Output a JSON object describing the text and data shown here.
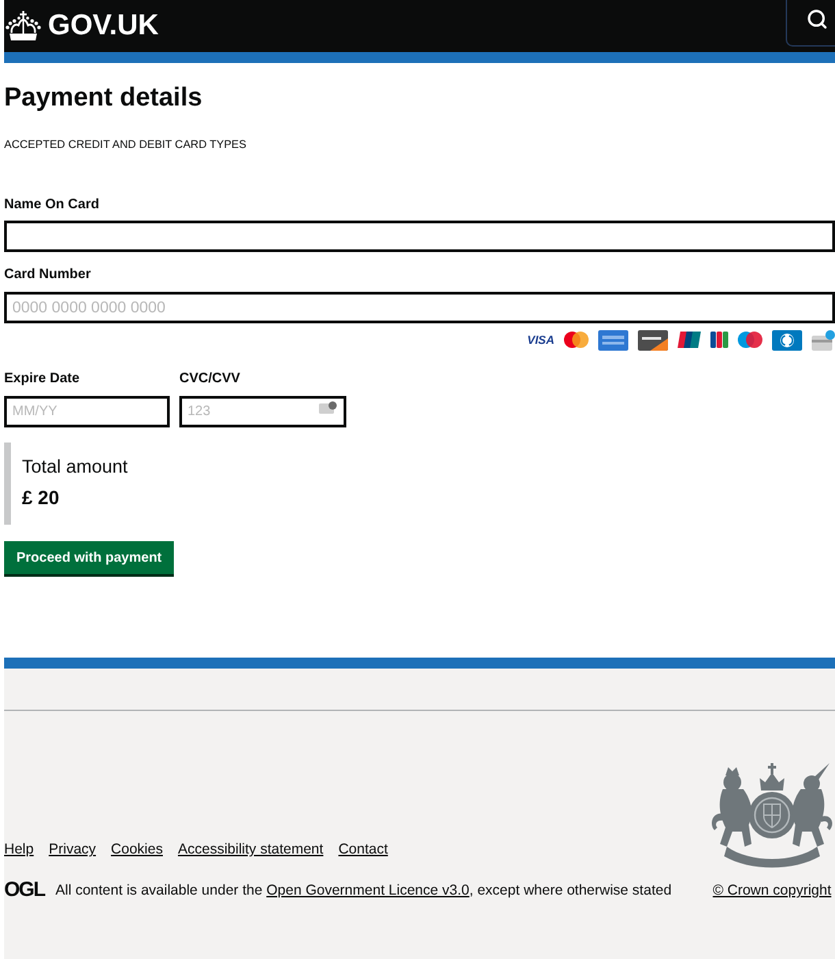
{
  "header": {
    "logo_text": "GOV.UK"
  },
  "form": {
    "title": "Payment details",
    "card_types_label": "ACCEPTED CREDIT AND DEBIT CARD TYPES",
    "name_on_card": {
      "label": "Name On Card"
    },
    "card_number": {
      "label": "Card Number",
      "placeholder": "0000 0000 0000 0000",
      "visa_logo": "VISA"
    },
    "expire_date": {
      "label": "Expire Date",
      "placeholder": "MM/YY"
    },
    "cvc": {
      "label": "CVC/CVV",
      "placeholder": "123"
    }
  },
  "total": {
    "label": "Total amount",
    "amount": "£ 20"
  },
  "submit_button": "Proceed with payment",
  "footer": {
    "links": [
      "Help",
      "Privacy",
      "Cookies",
      "Accessibility statement",
      "Contact"
    ],
    "ogl_logo": "OGL",
    "licence_before": "All content is available under the ",
    "licence_link": "Open Government Licence v3.0",
    "licence_after": ", except where otherwise stated",
    "copyright": "© Crown copyright"
  }
}
